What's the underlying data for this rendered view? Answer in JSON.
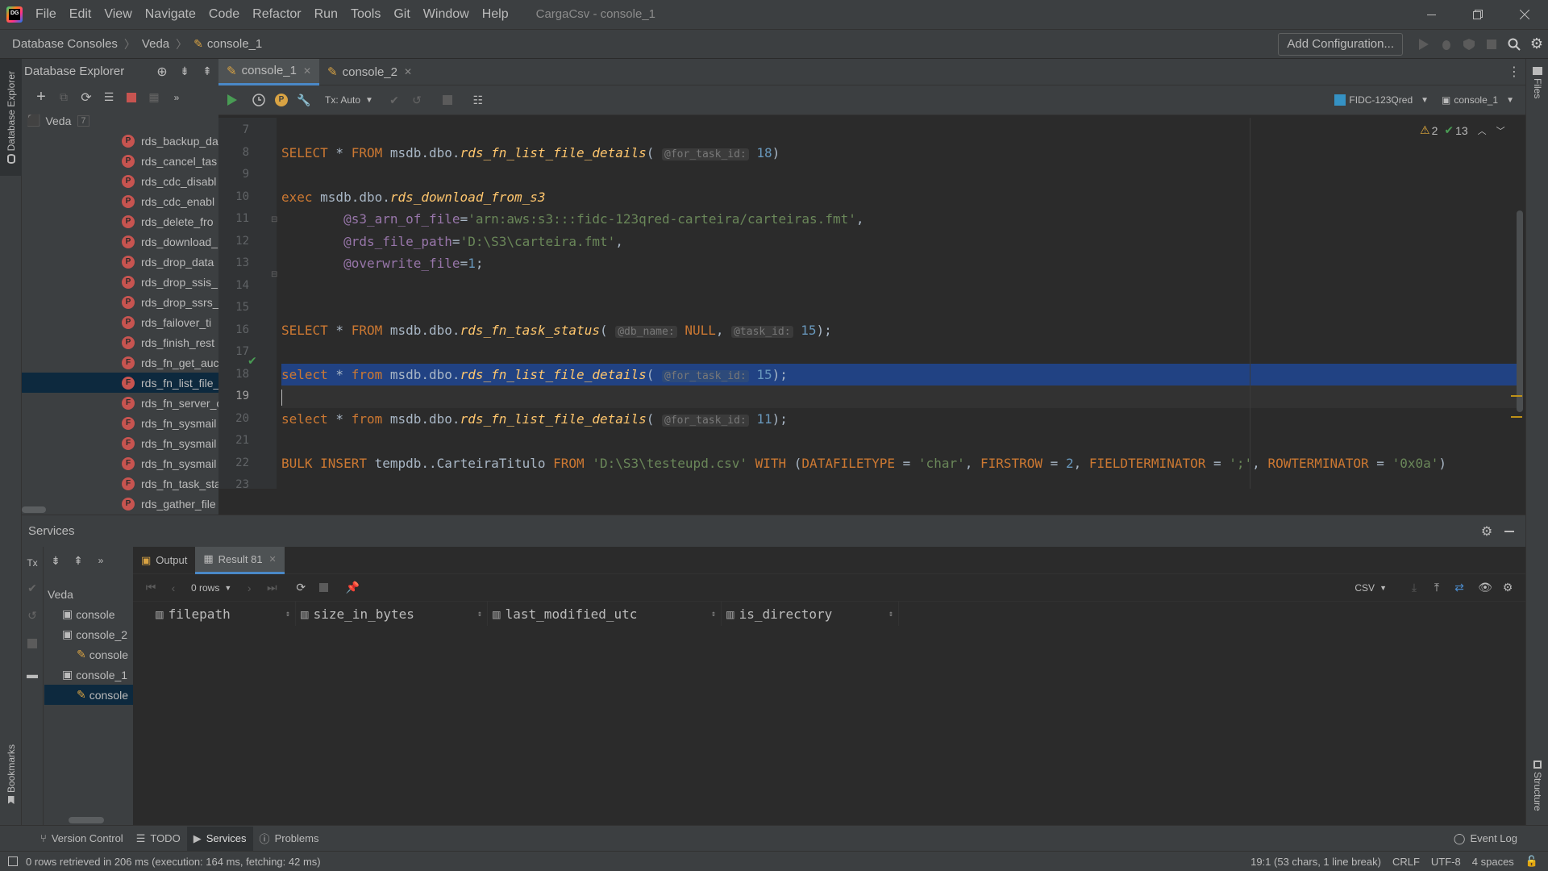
{
  "menubar": {
    "items": [
      "File",
      "Edit",
      "View",
      "Navigate",
      "Code",
      "Refactor",
      "Run",
      "Tools",
      "Git",
      "Window",
      "Help"
    ],
    "title": "CargaCsv - console_1"
  },
  "navbar": {
    "breadcrumbs": [
      "Database Consoles",
      "Veda",
      "console_1"
    ],
    "add_config_label": "Add Configuration..."
  },
  "left_strip": {
    "db_explorer_label": "Database Explorer",
    "bookmarks_label": "Bookmarks"
  },
  "right_strip": {
    "files_label": "Files",
    "structure_label": "Structure"
  },
  "db_explorer": {
    "title": "Database Explorer",
    "root": "Veda",
    "root_count": "7",
    "items": [
      {
        "badge": "P",
        "label": "rds_backup_da"
      },
      {
        "badge": "P",
        "label": "rds_cancel_tas"
      },
      {
        "badge": "P",
        "label": "rds_cdc_disabl"
      },
      {
        "badge": "P",
        "label": "rds_cdc_enabl"
      },
      {
        "badge": "P",
        "label": "rds_delete_fro"
      },
      {
        "badge": "P",
        "label": "rds_download_"
      },
      {
        "badge": "P",
        "label": "rds_drop_data"
      },
      {
        "badge": "P",
        "label": "rds_drop_ssis_"
      },
      {
        "badge": "P",
        "label": "rds_drop_ssrs_"
      },
      {
        "badge": "P",
        "label": "rds_failover_ti"
      },
      {
        "badge": "P",
        "label": "rds_finish_rest"
      },
      {
        "badge": "F",
        "label": "rds_fn_get_auc"
      },
      {
        "badge": "F",
        "label": "rds_fn_list_file_"
      },
      {
        "badge": "F",
        "label": "rds_fn_server_c"
      },
      {
        "badge": "F",
        "label": "rds_fn_sysmail"
      },
      {
        "badge": "F",
        "label": "rds_fn_sysmail"
      },
      {
        "badge": "F",
        "label": "rds_fn_sysmail"
      },
      {
        "badge": "F",
        "label": "rds_fn_task_sta"
      },
      {
        "badge": "P",
        "label": "rds_gather_file"
      }
    ],
    "selected_index": 12
  },
  "editor": {
    "tabs": [
      {
        "label": "console_1",
        "active": true
      },
      {
        "label": "console_2",
        "active": false
      }
    ],
    "tx_label": "Tx: Auto",
    "datasource": "FIDC-123Qred",
    "session": "console_1",
    "warnings": "2",
    "oks": "13",
    "line_numbers": [
      "7",
      "8",
      "9",
      "10",
      "11",
      "12",
      "13",
      "14",
      "15",
      "16",
      "17",
      "18",
      "19",
      "20",
      "21",
      "22",
      "23"
    ],
    "lines": {
      "l8_hint": "@for_task_id:",
      "l8_num": "18",
      "l11_str": "'arn:aws:s3:::fidc-123qred-carteira/carteiras.fmt'",
      "l12_str": "'D:\\S3\\carteira.fmt'",
      "l13_num": "1",
      "l16_hint1": "@db_name:",
      "l16_hint2": "@task_id:",
      "l16_num": "15",
      "l18_hint": "@for_task_id:",
      "l18_num": "15",
      "l20_hint": "@for_task_id:",
      "l20_num": "11",
      "l22_str1": "'D:\\S3\\testeupd.csv'",
      "l22_str2": "'char'",
      "l22_num": "2",
      "l22_str3": "';'",
      "l22_str4": "'0x0a'"
    }
  },
  "services": {
    "title": "Services",
    "tree": [
      {
        "label": "Veda",
        "level": 0
      },
      {
        "label": "console",
        "level": 1
      },
      {
        "label": "console_2",
        "level": 1
      },
      {
        "label": "console",
        "level": 2
      },
      {
        "label": "console_1",
        "level": 1
      },
      {
        "label": "console",
        "level": 2
      }
    ],
    "output_tab": "Output",
    "result_tab": "Result 81",
    "rows_label": "0 rows",
    "export_format": "CSV",
    "columns": [
      "filepath",
      "size_in_bytes",
      "last_modified_utc",
      "is_directory"
    ]
  },
  "bottombar": {
    "items": [
      "Version Control",
      "TODO",
      "Services",
      "Problems"
    ],
    "event_log": "Event Log"
  },
  "statusbar": {
    "message": "0 rows retrieved in 206 ms (execution: 164 ms, fetching: 42 ms)",
    "position": "19:1 (53 chars, 1 line break)",
    "line_sep": "CRLF",
    "encoding": "UTF-8",
    "indent": "4 spaces"
  },
  "colors": {
    "accent": "#4a88c7",
    "selection": "#214283",
    "keyword": "#cc7832",
    "function": "#ffc66d",
    "string": "#6a8759",
    "number": "#6897bb",
    "run": "#499c54"
  }
}
